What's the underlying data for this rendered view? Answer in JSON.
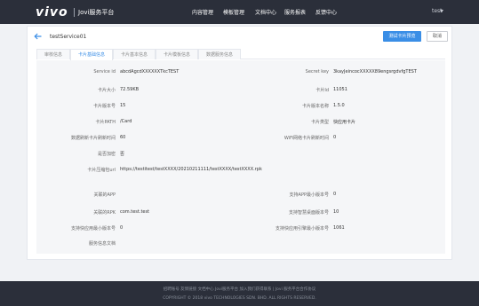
{
  "header": {
    "logo": "vivo",
    "subtitle": "Jovi服务平台",
    "nav": [
      "内容管理",
      "模板管理",
      "文档中心",
      "服务报表",
      "反馈中心"
    ],
    "user": "test"
  },
  "detail": {
    "title": "testService01",
    "primary_button": "测试卡片预览",
    "cancel_button": "取消",
    "tabs": [
      "审核信息",
      "卡片基础信息",
      "卡片基本信息",
      "卡片模板信息",
      "数据服务信息"
    ],
    "active_tab_index": 1,
    "fields": {
      "service_id_label": "Service id",
      "service_id_value": "abcdAgcdXXXXXXTkcTEST",
      "secret_key_label": "Secret key",
      "secret_key_value": "3kayJeincocXXXXX89engsrgdvfgTEST",
      "card_size_label": "卡片大小",
      "card_size_value": "72.59KB",
      "card_id_label": "卡片Id",
      "card_id_value": "11051",
      "card_version_code_label": "卡片版本号",
      "card_version_code_value": "15",
      "card_version_name_label": "卡片版本名称",
      "card_version_name_value": "1.5.0",
      "card_path_label": "卡片PATH",
      "card_path_value": "/Card",
      "card_type_label": "卡片类型",
      "card_type_value": "快应用卡片",
      "refresh_interval_label": "数据刷新卡片刷新时间",
      "refresh_interval_value": "60",
      "wifi_refresh_label": "WiFi网络卡片刷新时间",
      "wifi_refresh_value": "0",
      "encrypt_label": "是否加密",
      "encrypt_value": "否",
      "download_url_label": "卡片压缩包url",
      "download_url_value": "https://testitest/testXXXX/20210211111/testXXXX/testXXXX.rpk",
      "app_label": "关联的APP",
      "app_value": "",
      "app_min_version_label": "支持APP最小版本号",
      "app_min_version_value": "0",
      "rpk_label": "关联的RPK",
      "rpk_value": "com.test.test",
      "engine_min_version_label": "支持智慧桌面版本号",
      "engine_min_version_value": "10",
      "quickapp_min_version_label": "支持快应用最小版本号",
      "quickapp_min_version_value": "0",
      "platform_min_version_label": "支持快应用引擎最小版本号",
      "platform_min_version_value": "1061",
      "doc_label": "服务信息文档",
      "doc_value": ""
    }
  },
  "footer": {
    "line1": "招聘账号  友情链接  文档中心  Jovi服务平台  加入我们获得联系  |  Jovi 服务平台合作协议",
    "line2": "COPYRIGHT © 2018 vivo TECHNOLOGIES SDN. BHD. ALL RIGHTS RESERVED."
  },
  "colors": {
    "nav_bg": "#2b2f3a",
    "accent": "#3a8ee6",
    "page_bg": "#f0f2f5"
  }
}
